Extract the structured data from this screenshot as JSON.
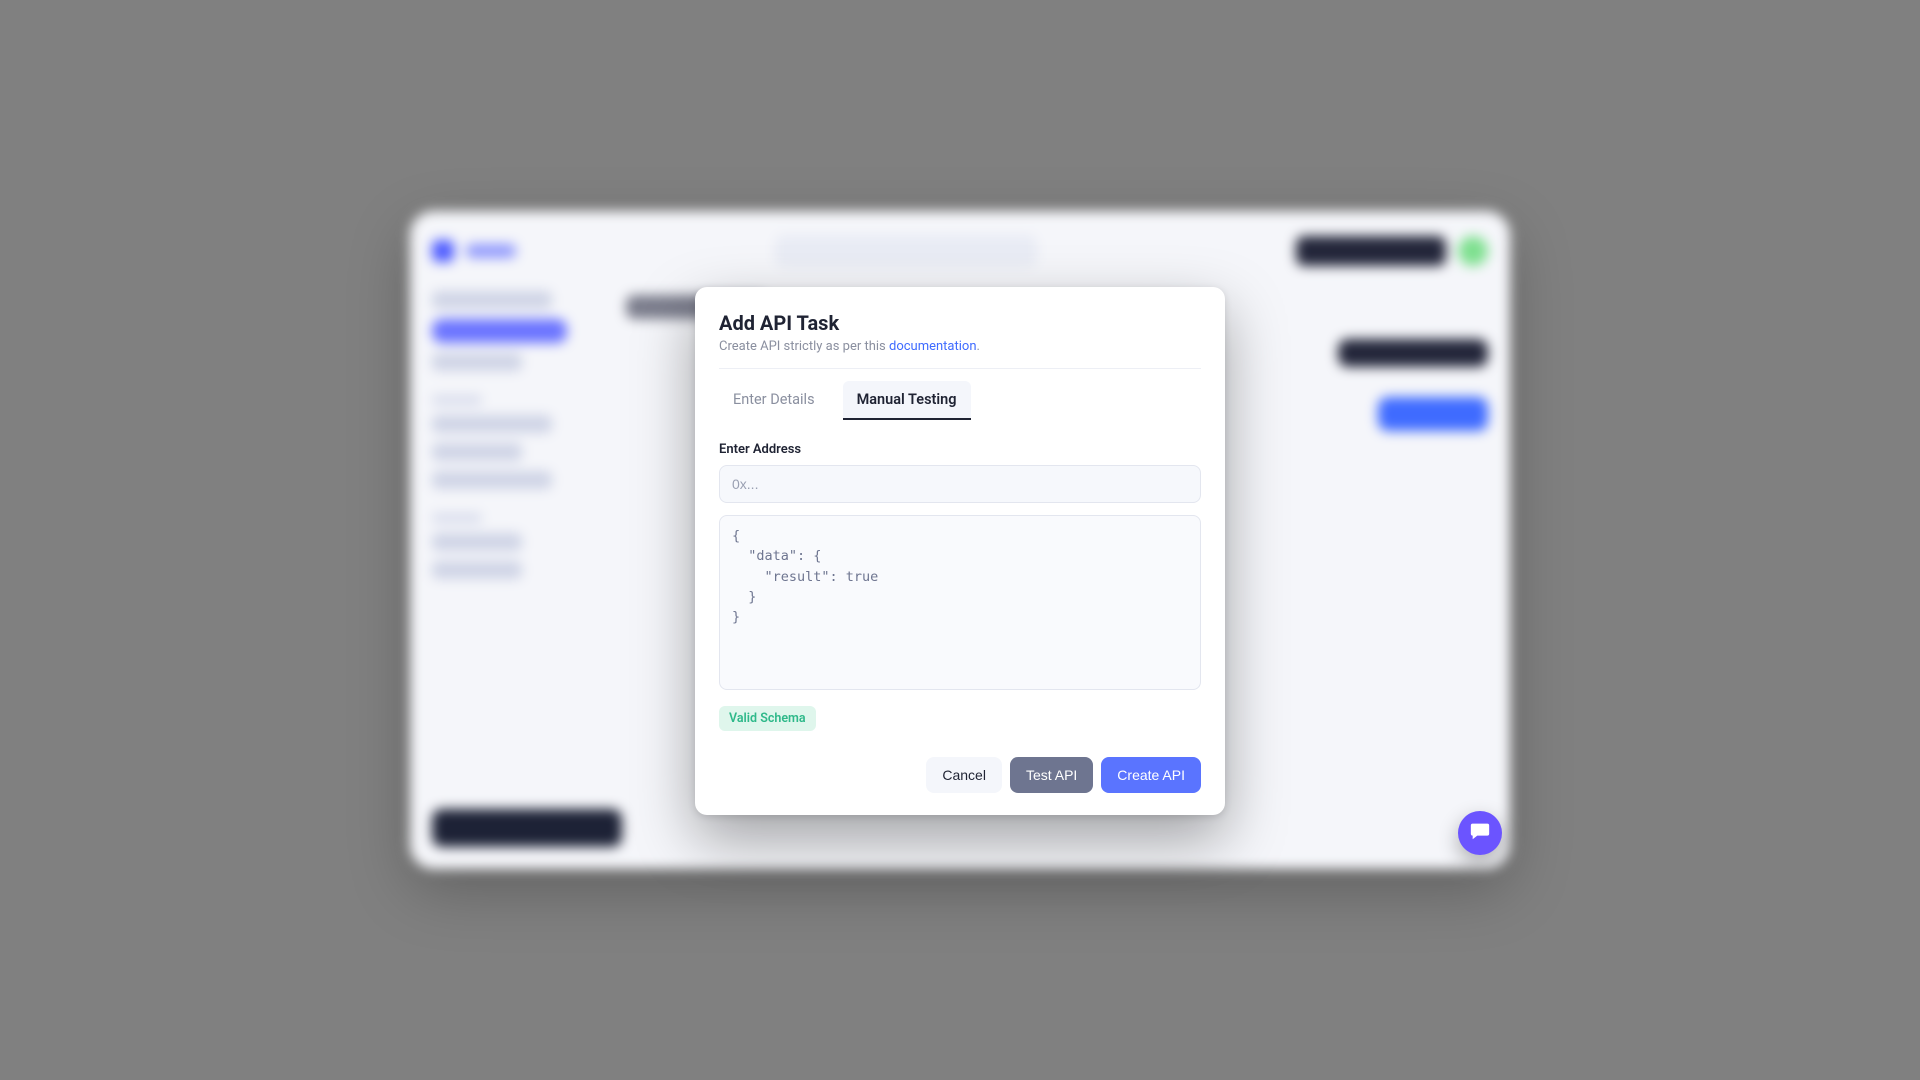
{
  "modal": {
    "title": "Add API Task",
    "subtitle_prefix": "Create API strictly as per this ",
    "subtitle_link": "documentation",
    "subtitle_suffix": ".",
    "tabs": {
      "enter_details": "Enter Details",
      "manual_testing": "Manual Testing"
    },
    "active_tab": "manual_testing",
    "address_label": "Enter Address",
    "address_placeholder": "0x...",
    "address_value": "",
    "schema_value": "{\n  \"data\": {\n    \"result\": true\n  }\n}",
    "badge": "Valid Schema",
    "actions": {
      "cancel": "Cancel",
      "test": "Test API",
      "create": "Create API"
    }
  },
  "fab": {
    "name": "chat"
  }
}
